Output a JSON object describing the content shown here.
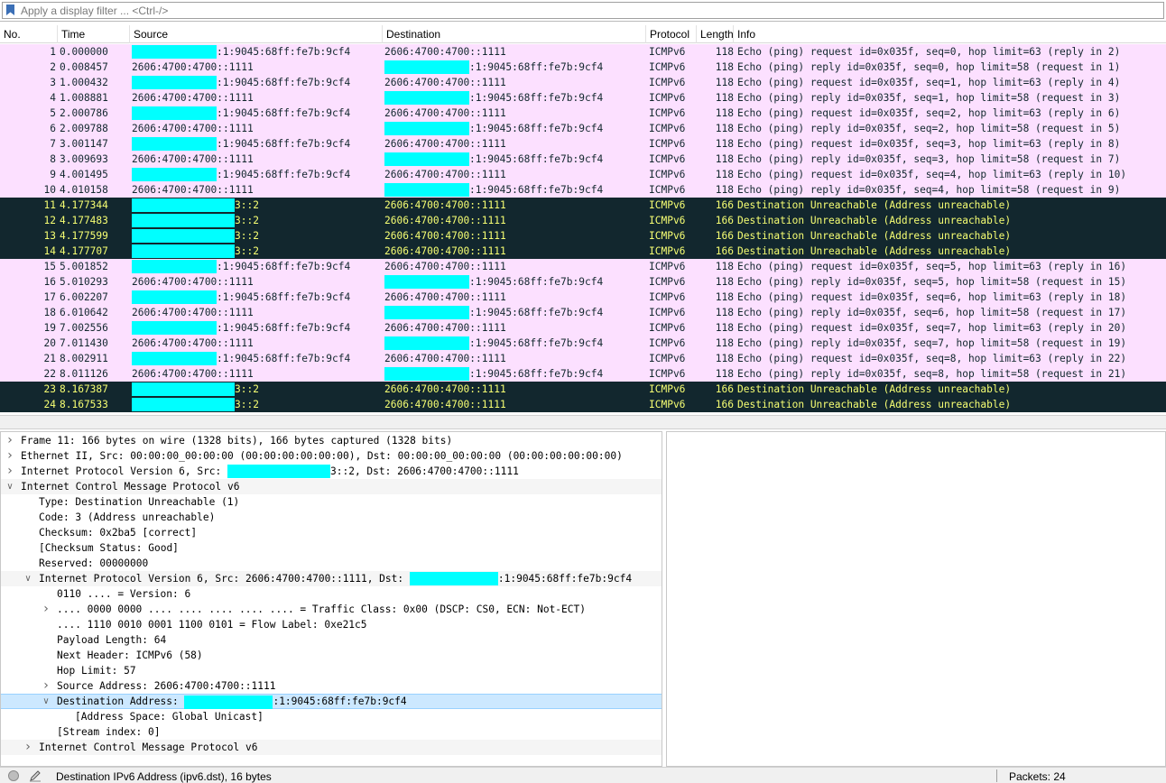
{
  "filter": {
    "placeholder": "Apply a display filter ... <Ctrl-/>"
  },
  "columns": {
    "no": "No.",
    "time": "Time",
    "source": "Source",
    "destination": "Destination",
    "protocol": "Protocol",
    "length": "Length",
    "info": "Info"
  },
  "colors": {
    "icmp_bg": "#fce0ff",
    "icmp_fg": "#12272e",
    "err_bg": "#12272e",
    "err_fg": "#f7ff73",
    "redaction": "#00ffff",
    "selection": "#cce8ff"
  },
  "packets": [
    {
      "no": "1",
      "time": "0.000000",
      "src": ":1:9045:68ff:fe7b:9cf4",
      "dst": "2606:4700:4700::1111",
      "proto": "ICMPv6",
      "len": "118",
      "info": "Echo (ping) request id=0x035f, seq=0, hop limit=63 (reply in 2)"
    },
    {
      "no": "2",
      "time": "0.008457",
      "src": "2606:4700:4700::1111",
      "dst": ":1:9045:68ff:fe7b:9cf4",
      "proto": "ICMPv6",
      "len": "118",
      "info": "Echo (ping) reply id=0x035f, seq=0, hop limit=58 (request in 1)"
    },
    {
      "no": "3",
      "time": "1.000432",
      "src": ":1:9045:68ff:fe7b:9cf4",
      "dst": "2606:4700:4700::1111",
      "proto": "ICMPv6",
      "len": "118",
      "info": "Echo (ping) request id=0x035f, seq=1, hop limit=63 (reply in 4)"
    },
    {
      "no": "4",
      "time": "1.008881",
      "src": "2606:4700:4700::1111",
      "dst": ":1:9045:68ff:fe7b:9cf4",
      "proto": "ICMPv6",
      "len": "118",
      "info": "Echo (ping) reply id=0x035f, seq=1, hop limit=58 (request in 3)"
    },
    {
      "no": "5",
      "time": "2.000786",
      "src": ":1:9045:68ff:fe7b:9cf4",
      "dst": "2606:4700:4700::1111",
      "proto": "ICMPv6",
      "len": "118",
      "info": "Echo (ping) request id=0x035f, seq=2, hop limit=63 (reply in 6)"
    },
    {
      "no": "6",
      "time": "2.009788",
      "src": "2606:4700:4700::1111",
      "dst": ":1:9045:68ff:fe7b:9cf4",
      "proto": "ICMPv6",
      "len": "118",
      "info": "Echo (ping) reply id=0x035f, seq=2, hop limit=58 (request in 5)"
    },
    {
      "no": "7",
      "time": "3.001147",
      "src": ":1:9045:68ff:fe7b:9cf4",
      "dst": "2606:4700:4700::1111",
      "proto": "ICMPv6",
      "len": "118",
      "info": "Echo (ping) request id=0x035f, seq=3, hop limit=63 (reply in 8)"
    },
    {
      "no": "8",
      "time": "3.009693",
      "src": "2606:4700:4700::1111",
      "dst": ":1:9045:68ff:fe7b:9cf4",
      "proto": "ICMPv6",
      "len": "118",
      "info": "Echo (ping) reply id=0x035f, seq=3, hop limit=58 (request in 7)"
    },
    {
      "no": "9",
      "time": "4.001495",
      "src": ":1:9045:68ff:fe7b:9cf4",
      "dst": "2606:4700:4700::1111",
      "proto": "ICMPv6",
      "len": "118",
      "info": "Echo (ping) request id=0x035f, seq=4, hop limit=63 (reply in 10)"
    },
    {
      "no": "10",
      "time": "4.010158",
      "src": "2606:4700:4700::1111",
      "dst": ":1:9045:68ff:fe7b:9cf4",
      "proto": "ICMPv6",
      "len": "118",
      "info": "Echo (ping) reply id=0x035f, seq=4, hop limit=58 (request in 9)"
    },
    {
      "no": "11",
      "time": "4.177344",
      "src": "3::2",
      "dst": "2606:4700:4700::1111",
      "proto": "ICMPv6",
      "len": "166",
      "info": "Destination Unreachable (Address unreachable)"
    },
    {
      "no": "12",
      "time": "4.177483",
      "src": "3::2",
      "dst": "2606:4700:4700::1111",
      "proto": "ICMPv6",
      "len": "166",
      "info": "Destination Unreachable (Address unreachable)"
    },
    {
      "no": "13",
      "time": "4.177599",
      "src": "3::2",
      "dst": "2606:4700:4700::1111",
      "proto": "ICMPv6",
      "len": "166",
      "info": "Destination Unreachable (Address unreachable)"
    },
    {
      "no": "14",
      "time": "4.177707",
      "src": "3::2",
      "dst": "2606:4700:4700::1111",
      "proto": "ICMPv6",
      "len": "166",
      "info": "Destination Unreachable (Address unreachable)"
    },
    {
      "no": "15",
      "time": "5.001852",
      "src": ":1:9045:68ff:fe7b:9cf4",
      "dst": "2606:4700:4700::1111",
      "proto": "ICMPv6",
      "len": "118",
      "info": "Echo (ping) request id=0x035f, seq=5, hop limit=63 (reply in 16)"
    },
    {
      "no": "16",
      "time": "5.010293",
      "src": "2606:4700:4700::1111",
      "dst": ":1:9045:68ff:fe7b:9cf4",
      "proto": "ICMPv6",
      "len": "118",
      "info": "Echo (ping) reply id=0x035f, seq=5, hop limit=58 (request in 15)"
    },
    {
      "no": "17",
      "time": "6.002207",
      "src": ":1:9045:68ff:fe7b:9cf4",
      "dst": "2606:4700:4700::1111",
      "proto": "ICMPv6",
      "len": "118",
      "info": "Echo (ping) request id=0x035f, seq=6, hop limit=63 (reply in 18)"
    },
    {
      "no": "18",
      "time": "6.010642",
      "src": "2606:4700:4700::1111",
      "dst": ":1:9045:68ff:fe7b:9cf4",
      "proto": "ICMPv6",
      "len": "118",
      "info": "Echo (ping) reply id=0x035f, seq=6, hop limit=58 (request in 17)"
    },
    {
      "no": "19",
      "time": "7.002556",
      "src": ":1:9045:68ff:fe7b:9cf4",
      "dst": "2606:4700:4700::1111",
      "proto": "ICMPv6",
      "len": "118",
      "info": "Echo (ping) request id=0x035f, seq=7, hop limit=63 (reply in 20)"
    },
    {
      "no": "20",
      "time": "7.011430",
      "src": "2606:4700:4700::1111",
      "dst": ":1:9045:68ff:fe7b:9cf4",
      "proto": "ICMPv6",
      "len": "118",
      "info": "Echo (ping) reply id=0x035f, seq=7, hop limit=58 (request in 19)"
    },
    {
      "no": "21",
      "time": "8.002911",
      "src": ":1:9045:68ff:fe7b:9cf4",
      "dst": "2606:4700:4700::1111",
      "proto": "ICMPv6",
      "len": "118",
      "info": "Echo (ping) request id=0x035f, seq=8, hop limit=63 (reply in 22)"
    },
    {
      "no": "22",
      "time": "8.011126",
      "src": "2606:4700:4700::1111",
      "dst": ":1:9045:68ff:fe7b:9cf4",
      "proto": "ICMPv6",
      "len": "118",
      "info": "Echo (ping) reply id=0x035f, seq=8, hop limit=58 (request in 21)"
    },
    {
      "no": "23",
      "time": "8.167387",
      "src": "3::2",
      "dst": "2606:4700:4700::1111",
      "proto": "ICMPv6",
      "len": "166",
      "info": "Destination Unreachable (Address unreachable)"
    },
    {
      "no": "24",
      "time": "8.167533",
      "src": "3::2",
      "dst": "2606:4700:4700::1111",
      "proto": "ICMPv6",
      "len": "166",
      "info": "Destination Unreachable (Address unreachable)"
    }
  ],
  "details": [
    {
      "expander": "collapsed",
      "text": "Frame 11: 166 bytes on wire (1328 bits), 166 bytes captured (1328 bits)"
    },
    {
      "expander": "collapsed",
      "text": "Ethernet II, Src: 00:00:00_00:00:00 (00:00:00:00:00:00), Dst: 00:00:00_00:00:00 (00:00:00:00:00:00)"
    },
    {
      "expander": "collapsed",
      "text": "Internet Protocol Version 6, Src: ",
      "redacted_after": "3::2, Dst: 2606:4700:4700::1111"
    },
    {
      "expander": "expanded",
      "text": "Internet Control Message Protocol v6"
    },
    {
      "expander": "none",
      "text": "Type: Destination Unreachable (1)"
    },
    {
      "expander": "none",
      "text": "Code: 3 (Address unreachable)"
    },
    {
      "expander": "none",
      "text": "Checksum: 0x2ba5 [correct]"
    },
    {
      "expander": "none",
      "text": "[Checksum Status: Good]"
    },
    {
      "expander": "none",
      "text": "Reserved: 00000000"
    },
    {
      "expander": "expanded",
      "text": "Internet Protocol Version 6, Src: 2606:4700:4700::1111, Dst: ",
      "redacted_after": ":1:9045:68ff:fe7b:9cf4"
    },
    {
      "expander": "none",
      "text": "0110 .... = Version: 6"
    },
    {
      "expander": "collapsed",
      "text": ".... 0000 0000 .... .... .... .... .... = Traffic Class: 0x00 (DSCP: CS0, ECN: Not-ECT)"
    },
    {
      "expander": "none",
      "text": ".... 1110 0010 0001 1100 0101 = Flow Label: 0xe21c5"
    },
    {
      "expander": "none",
      "text": "Payload Length: 64"
    },
    {
      "expander": "none",
      "text": "Next Header: ICMPv6 (58)"
    },
    {
      "expander": "none",
      "text": "Hop Limit: 57"
    },
    {
      "expander": "collapsed",
      "text": "Source Address: 2606:4700:4700::1111"
    },
    {
      "expander": "expanded",
      "text": "Destination Address: ",
      "redacted_after": ":1:9045:68ff:fe7b:9cf4"
    },
    {
      "expander": "none",
      "text": "[Address Space: Global Unicast]"
    },
    {
      "expander": "none",
      "text": "[Stream index: 0]"
    },
    {
      "expander": "collapsed",
      "text": "Internet Control Message Protocol v6"
    }
  ],
  "status": {
    "text": "Destination IPv6 Address (ipv6.dst), 16 bytes",
    "packets": "Packets: 24"
  }
}
